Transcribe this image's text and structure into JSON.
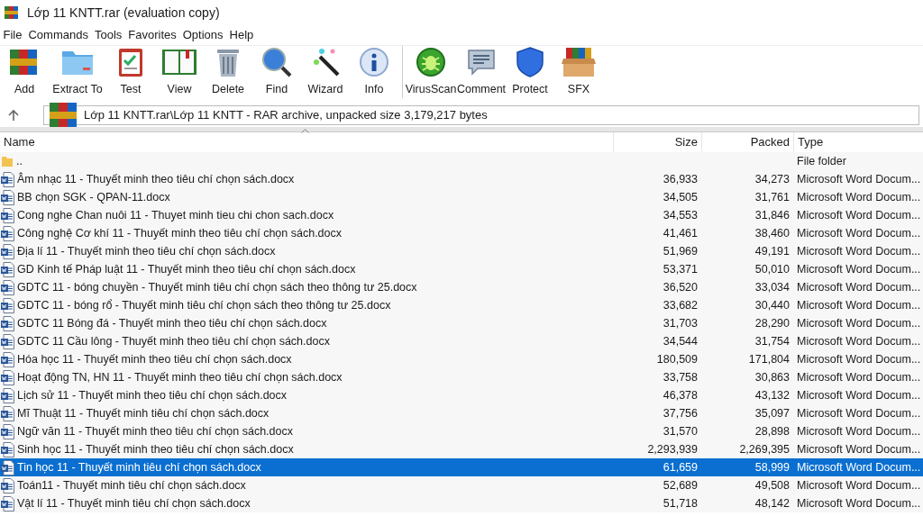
{
  "window": {
    "title": "Lớp 11 KNTT.rar (evaluation copy)"
  },
  "menu": [
    "File",
    "Commands",
    "Tools",
    "Favorites",
    "Options",
    "Help"
  ],
  "toolbar": [
    {
      "label": "Add"
    },
    {
      "label": "Extract To"
    },
    {
      "label": "Test"
    },
    {
      "label": "View"
    },
    {
      "label": "Delete"
    },
    {
      "label": "Find"
    },
    {
      "label": "Wizard"
    },
    {
      "label": "Info"
    },
    {
      "label": "VirusScan"
    },
    {
      "label": "Comment"
    },
    {
      "label": "Protect"
    },
    {
      "label": "SFX"
    }
  ],
  "address": "Lớp 11 KNTT.rar\\Lớp 11 KNTT - RAR archive, unpacked size 3,179,217 bytes",
  "table": {
    "columns": [
      "Name",
      "Size",
      "Packed",
      "Type"
    ],
    "rows": [
      {
        "kind": "folder",
        "name": "..",
        "size": "",
        "packed": "",
        "type": "File folder",
        "selected": false
      },
      {
        "kind": "document",
        "name": "Âm nhạc 11 - Thuyết minh theo tiêu chí chọn sách.docx",
        "size": "36,933",
        "packed": "34,273",
        "type": "Microsoft Word Docum...",
        "selected": false
      },
      {
        "kind": "document",
        "name": "BB chọn SGK - QPAN-11.docx",
        "size": "34,505",
        "packed": "31,761",
        "type": "Microsoft Word Docum...",
        "selected": false
      },
      {
        "kind": "document",
        "name": "Cong nghe Chan nuôi 11 - Thuyet minh tieu chi chon sach.docx",
        "size": "34,553",
        "packed": "31,846",
        "type": "Microsoft Word Docum...",
        "selected": false
      },
      {
        "kind": "document",
        "name": "Công nghệ Cơ khí 11 - Thuyết minh theo tiêu chí chọn sách.docx",
        "size": "41,461",
        "packed": "38,460",
        "type": "Microsoft Word Docum...",
        "selected": false
      },
      {
        "kind": "document",
        "name": "Địa lí 11 - Thuyết minh theo tiêu chí chọn sách.docx",
        "size": "51,969",
        "packed": "49,191",
        "type": "Microsoft Word Docum...",
        "selected": false
      },
      {
        "kind": "document",
        "name": "GD Kinh tế Pháp luật 11 - Thuyết minh theo tiêu chí chọn sách.docx",
        "size": "53,371",
        "packed": "50,010",
        "type": "Microsoft Word Docum...",
        "selected": false
      },
      {
        "kind": "document",
        "name": "GDTC 11 - bóng chuyền - Thuyết minh tiêu chí chọn sách theo thông tư 25.docx",
        "size": "36,520",
        "packed": "33,034",
        "type": "Microsoft Word Docum...",
        "selected": false
      },
      {
        "kind": "document",
        "name": "GDTC 11 - bóng rổ - Thuyết minh tiêu chí chọn sách theo thông tư 25.docx",
        "size": "33,682",
        "packed": "30,440",
        "type": "Microsoft Word Docum...",
        "selected": false
      },
      {
        "kind": "document",
        "name": "GDTC 11 Bóng đá - Thuyết minh theo tiêu chí chọn sách.docx",
        "size": "31,703",
        "packed": "28,290",
        "type": "Microsoft Word Docum...",
        "selected": false
      },
      {
        "kind": "document",
        "name": "GDTC 11 Cầu lông - Thuyết minh theo tiêu chí chọn sách.docx",
        "size": "34,544",
        "packed": "31,754",
        "type": "Microsoft Word Docum...",
        "selected": false
      },
      {
        "kind": "document",
        "name": "Hóa học 11 - Thuyết minh theo tiêu chí chọn sách.docx",
        "size": "180,509",
        "packed": "171,804",
        "type": "Microsoft Word Docum...",
        "selected": false
      },
      {
        "kind": "document",
        "name": "Hoạt động TN, HN 11 - Thuyết minh theo tiêu chí chọn sách.docx",
        "size": "33,758",
        "packed": "30,863",
        "type": "Microsoft Word Docum...",
        "selected": false
      },
      {
        "kind": "document",
        "name": "Lịch sử 11 - Thuyết minh theo tiêu chí chọn sách.docx",
        "size": "46,378",
        "packed": "43,132",
        "type": "Microsoft Word Docum...",
        "selected": false
      },
      {
        "kind": "document",
        "name": "Mĩ Thuật 11 - Thuyết minh tiêu chí chọn sách.docx",
        "size": "37,756",
        "packed": "35,097",
        "type": "Microsoft Word Docum...",
        "selected": false
      },
      {
        "kind": "document",
        "name": "Ngữ văn 11 - Thuyết minh theo tiêu chí chọn sách.docx",
        "size": "31,570",
        "packed": "28,898",
        "type": "Microsoft Word Docum...",
        "selected": false
      },
      {
        "kind": "document",
        "name": "Sinh học 11 - Thuyết minh theo tiêu chí chọn sách.docx",
        "size": "2,293,939",
        "packed": "2,269,395",
        "type": "Microsoft Word Docum...",
        "selected": false
      },
      {
        "kind": "document",
        "name": "Tin học 11 - Thuyết minh tiêu chí chọn sách.docx",
        "size": "61,659",
        "packed": "58,999",
        "type": "Microsoft Word Docum...",
        "selected": true
      },
      {
        "kind": "document",
        "name": "Toán11 - Thuyết minh tiêu chí chọn sách.docx",
        "size": "52,689",
        "packed": "49,508",
        "type": "Microsoft Word Docum...",
        "selected": false
      },
      {
        "kind": "document",
        "name": "Vật lí 11 - Thuyết minh tiêu chí chọn sách.docx",
        "size": "51,718",
        "packed": "48,142",
        "type": "Microsoft Word Docum...",
        "selected": false
      }
    ]
  }
}
